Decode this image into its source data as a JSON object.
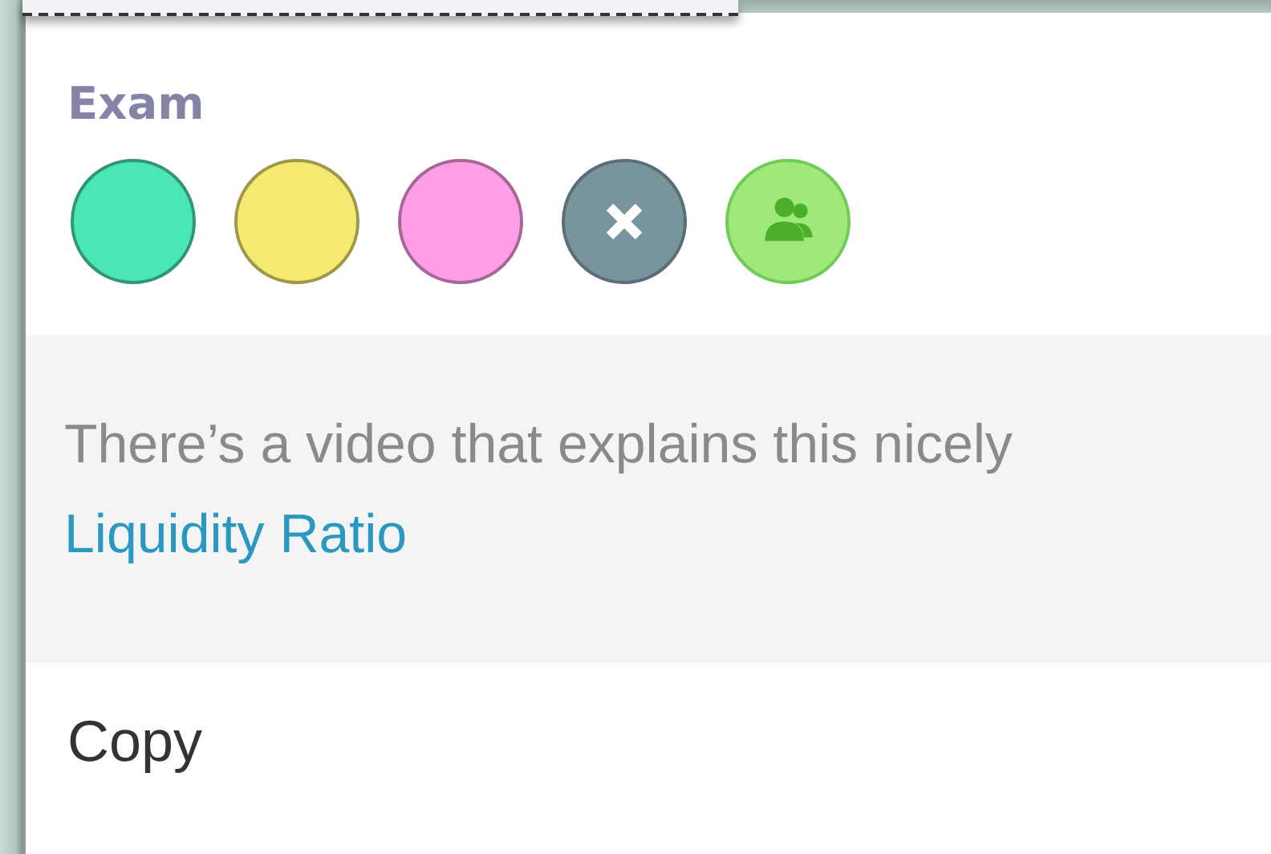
{
  "section": {
    "title": "Exam"
  },
  "swatches": [
    {
      "kind": "plain",
      "color": "#4ae6b6"
    },
    {
      "kind": "plain",
      "color": "#f4ea72"
    },
    {
      "kind": "plain",
      "color": "#ff9ee8"
    },
    {
      "kind": "close",
      "color": "#78949c"
    },
    {
      "kind": "group",
      "color": "#a0e87c"
    }
  ],
  "comment": {
    "text": "There’s a video that explains this nicely",
    "link": "Liquidity Ratio"
  },
  "action": {
    "label": "Copy"
  }
}
